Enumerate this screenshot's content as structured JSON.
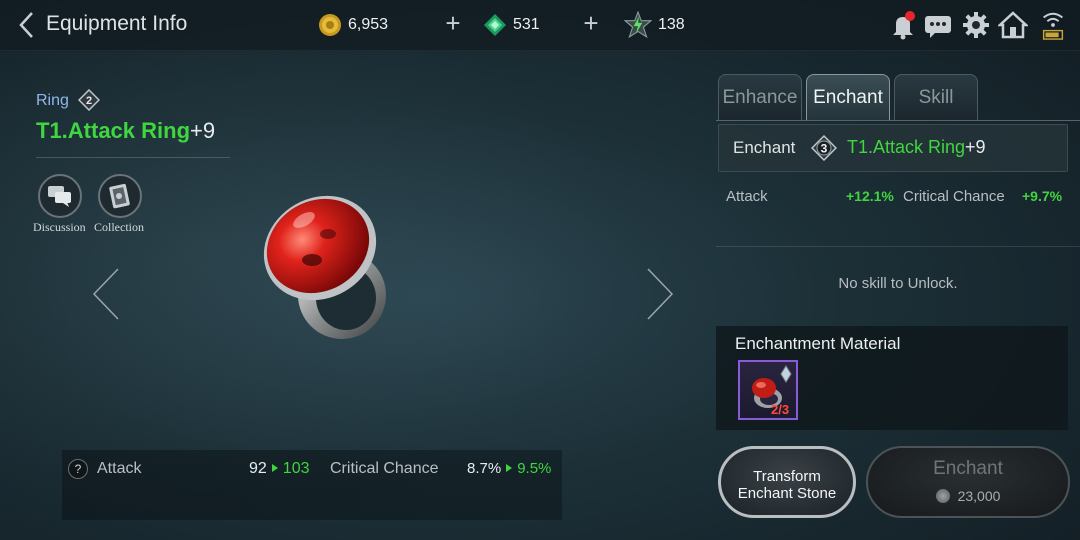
{
  "header": {
    "title": "Equipment Info",
    "gold": "6,953",
    "gems": "531",
    "energy": "138"
  },
  "item": {
    "type": "Ring",
    "grade": "2",
    "name": "T1.Attack Ring",
    "level": "+9"
  },
  "actions": {
    "discussion": "Discussion",
    "collection": "Collection"
  },
  "stats": {
    "attack_label": "Attack",
    "attack_from": "92",
    "attack_to": "103",
    "crit_label": "Critical Chance",
    "crit_from": "8.7%",
    "crit_to": "9.5%"
  },
  "tabs": {
    "enhance": "Enhance",
    "enchant": "Enchant",
    "skill": "Skill",
    "active": "Enchant"
  },
  "enchant": {
    "label": "Enchant",
    "grade": "3",
    "item_name": "T1.Attack Ring",
    "item_level": "+9",
    "attack_label": "Attack",
    "attack_bonus": "+12.1%",
    "crit_label": "Critical Chance",
    "crit_bonus": "+9.7%",
    "no_skill": "No skill to Unlock.",
    "material_title": "Enchantment Material",
    "material_count": "2/3",
    "transform_line1": "Transform",
    "transform_line2": "Enchant Stone",
    "button_label": "Enchant",
    "cost": "23,000"
  },
  "colors": {
    "accent_green": "#3fd63f",
    "item_type_blue": "#8fb7ea",
    "material_count_red": "#ff4a3a"
  }
}
